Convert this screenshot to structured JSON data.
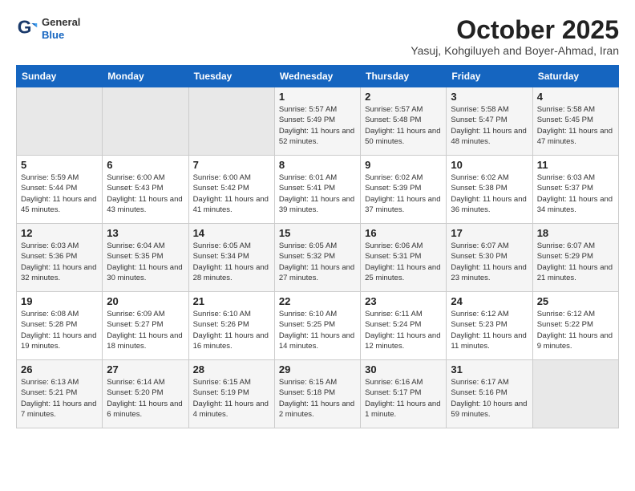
{
  "header": {
    "logo_general": "General",
    "logo_blue": "Blue",
    "month_title": "October 2025",
    "location": "Yasuj, Kohgiluyeh and Boyer-Ahmad, Iran"
  },
  "weekdays": [
    "Sunday",
    "Monday",
    "Tuesday",
    "Wednesday",
    "Thursday",
    "Friday",
    "Saturday"
  ],
  "weeks": [
    [
      {
        "day": "",
        "info": ""
      },
      {
        "day": "",
        "info": ""
      },
      {
        "day": "",
        "info": ""
      },
      {
        "day": "1",
        "info": "Sunrise: 5:57 AM\nSunset: 5:49 PM\nDaylight: 11 hours and 52 minutes."
      },
      {
        "day": "2",
        "info": "Sunrise: 5:57 AM\nSunset: 5:48 PM\nDaylight: 11 hours and 50 minutes."
      },
      {
        "day": "3",
        "info": "Sunrise: 5:58 AM\nSunset: 5:47 PM\nDaylight: 11 hours and 48 minutes."
      },
      {
        "day": "4",
        "info": "Sunrise: 5:58 AM\nSunset: 5:45 PM\nDaylight: 11 hours and 47 minutes."
      }
    ],
    [
      {
        "day": "5",
        "info": "Sunrise: 5:59 AM\nSunset: 5:44 PM\nDaylight: 11 hours and 45 minutes."
      },
      {
        "day": "6",
        "info": "Sunrise: 6:00 AM\nSunset: 5:43 PM\nDaylight: 11 hours and 43 minutes."
      },
      {
        "day": "7",
        "info": "Sunrise: 6:00 AM\nSunset: 5:42 PM\nDaylight: 11 hours and 41 minutes."
      },
      {
        "day": "8",
        "info": "Sunrise: 6:01 AM\nSunset: 5:41 PM\nDaylight: 11 hours and 39 minutes."
      },
      {
        "day": "9",
        "info": "Sunrise: 6:02 AM\nSunset: 5:39 PM\nDaylight: 11 hours and 37 minutes."
      },
      {
        "day": "10",
        "info": "Sunrise: 6:02 AM\nSunset: 5:38 PM\nDaylight: 11 hours and 36 minutes."
      },
      {
        "day": "11",
        "info": "Sunrise: 6:03 AM\nSunset: 5:37 PM\nDaylight: 11 hours and 34 minutes."
      }
    ],
    [
      {
        "day": "12",
        "info": "Sunrise: 6:03 AM\nSunset: 5:36 PM\nDaylight: 11 hours and 32 minutes."
      },
      {
        "day": "13",
        "info": "Sunrise: 6:04 AM\nSunset: 5:35 PM\nDaylight: 11 hours and 30 minutes."
      },
      {
        "day": "14",
        "info": "Sunrise: 6:05 AM\nSunset: 5:34 PM\nDaylight: 11 hours and 28 minutes."
      },
      {
        "day": "15",
        "info": "Sunrise: 6:05 AM\nSunset: 5:32 PM\nDaylight: 11 hours and 27 minutes."
      },
      {
        "day": "16",
        "info": "Sunrise: 6:06 AM\nSunset: 5:31 PM\nDaylight: 11 hours and 25 minutes."
      },
      {
        "day": "17",
        "info": "Sunrise: 6:07 AM\nSunset: 5:30 PM\nDaylight: 11 hours and 23 minutes."
      },
      {
        "day": "18",
        "info": "Sunrise: 6:07 AM\nSunset: 5:29 PM\nDaylight: 11 hours and 21 minutes."
      }
    ],
    [
      {
        "day": "19",
        "info": "Sunrise: 6:08 AM\nSunset: 5:28 PM\nDaylight: 11 hours and 19 minutes."
      },
      {
        "day": "20",
        "info": "Sunrise: 6:09 AM\nSunset: 5:27 PM\nDaylight: 11 hours and 18 minutes."
      },
      {
        "day": "21",
        "info": "Sunrise: 6:10 AM\nSunset: 5:26 PM\nDaylight: 11 hours and 16 minutes."
      },
      {
        "day": "22",
        "info": "Sunrise: 6:10 AM\nSunset: 5:25 PM\nDaylight: 11 hours and 14 minutes."
      },
      {
        "day": "23",
        "info": "Sunrise: 6:11 AM\nSunset: 5:24 PM\nDaylight: 11 hours and 12 minutes."
      },
      {
        "day": "24",
        "info": "Sunrise: 6:12 AM\nSunset: 5:23 PM\nDaylight: 11 hours and 11 minutes."
      },
      {
        "day": "25",
        "info": "Sunrise: 6:12 AM\nSunset: 5:22 PM\nDaylight: 11 hours and 9 minutes."
      }
    ],
    [
      {
        "day": "26",
        "info": "Sunrise: 6:13 AM\nSunset: 5:21 PM\nDaylight: 11 hours and 7 minutes."
      },
      {
        "day": "27",
        "info": "Sunrise: 6:14 AM\nSunset: 5:20 PM\nDaylight: 11 hours and 6 minutes."
      },
      {
        "day": "28",
        "info": "Sunrise: 6:15 AM\nSunset: 5:19 PM\nDaylight: 11 hours and 4 minutes."
      },
      {
        "day": "29",
        "info": "Sunrise: 6:15 AM\nSunset: 5:18 PM\nDaylight: 11 hours and 2 minutes."
      },
      {
        "day": "30",
        "info": "Sunrise: 6:16 AM\nSunset: 5:17 PM\nDaylight: 11 hours and 1 minute."
      },
      {
        "day": "31",
        "info": "Sunrise: 6:17 AM\nSunset: 5:16 PM\nDaylight: 10 hours and 59 minutes."
      },
      {
        "day": "",
        "info": ""
      }
    ]
  ]
}
